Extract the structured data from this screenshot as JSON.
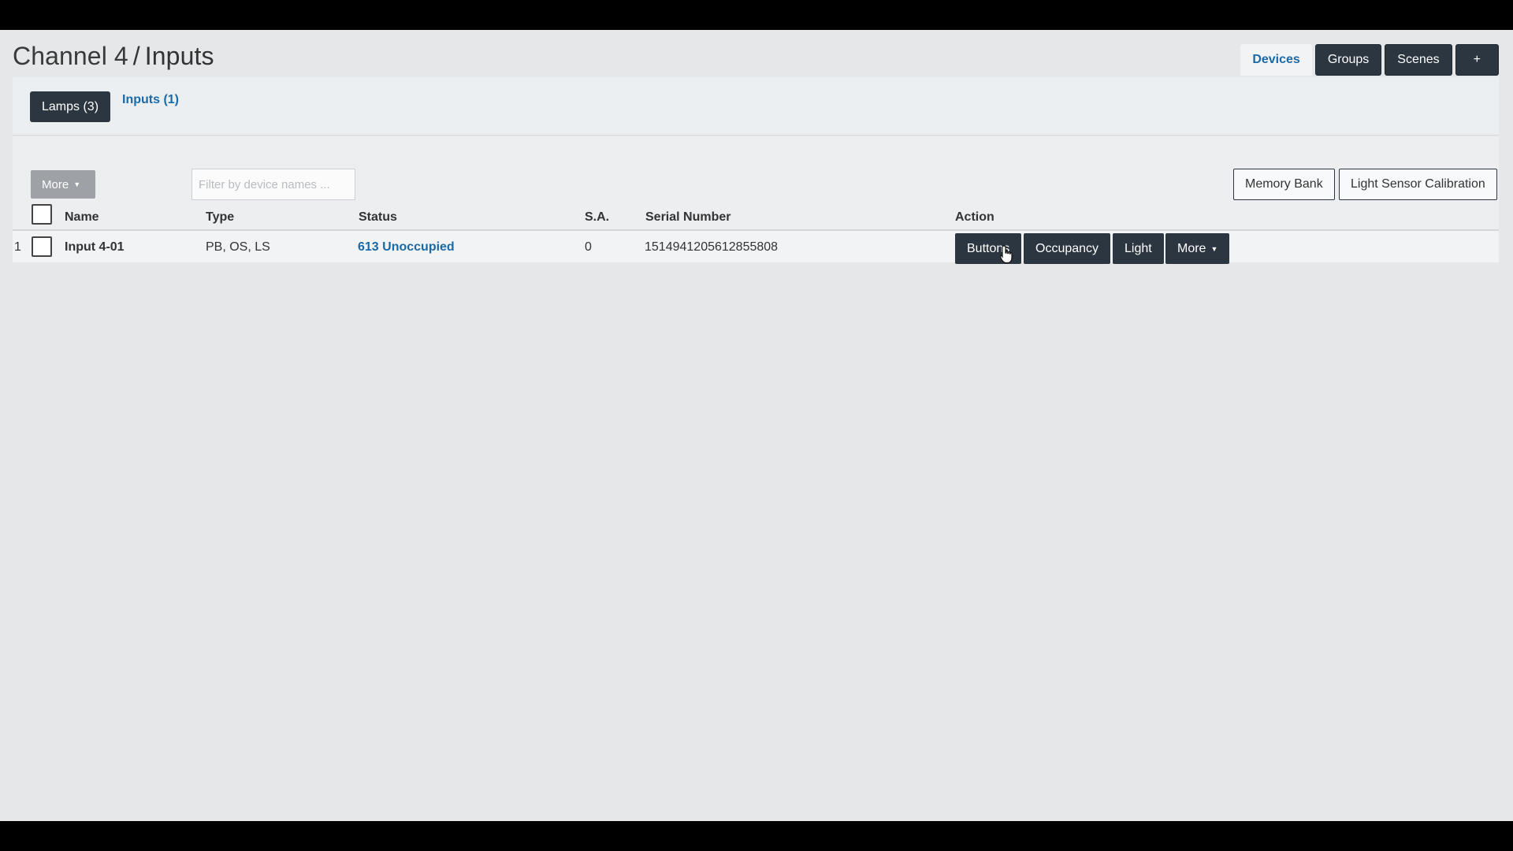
{
  "page": {
    "breadcrumb_parent": "Channel 4",
    "breadcrumb_separator": "/",
    "title": "Inputs"
  },
  "top_nav": {
    "items": [
      {
        "label": "Devices",
        "active": true
      },
      {
        "label": "Groups",
        "active": false
      },
      {
        "label": "Scenes",
        "active": false
      },
      {
        "label": "+",
        "active": false
      }
    ]
  },
  "sub_tabs": [
    {
      "label": "Lamps (3)",
      "active": true
    },
    {
      "label": "Inputs (1)",
      "active": false
    }
  ],
  "toolbar": {
    "more_label": "More",
    "filter_placeholder": "Filter by device names ...",
    "memory_bank_label": "Memory Bank",
    "light_sensor_calibration_label": "Light Sensor Calibration"
  },
  "table": {
    "columns": [
      "Name",
      "Type",
      "Status",
      "S.A.",
      "Serial Number",
      "Action"
    ],
    "rows": [
      {
        "index": "1",
        "name": "Input 4-01",
        "type": "PB, OS, LS",
        "status": "613 Unoccupied",
        "sa": "0",
        "serial": "1514941205612855808",
        "actions": [
          "Buttons",
          "Occupancy",
          "Light",
          "More"
        ]
      }
    ]
  },
  "colors": {
    "dark_button": "#2b3640",
    "link_blue": "#1a6aa8",
    "background": "#e6e7e8"
  }
}
